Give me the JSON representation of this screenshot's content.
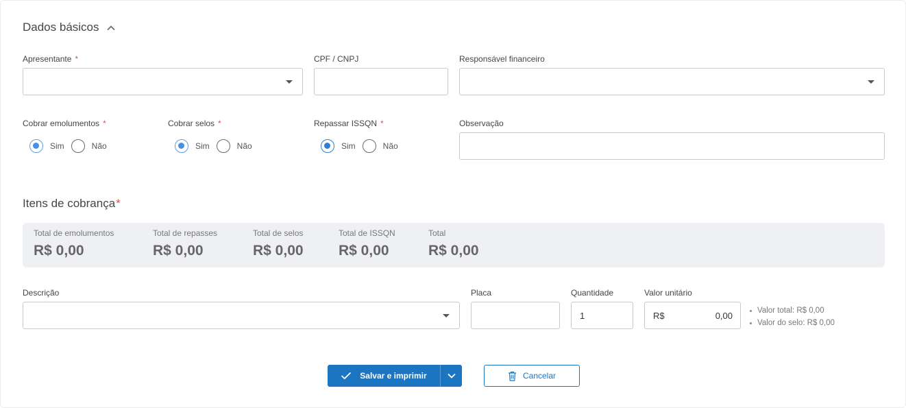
{
  "basic": {
    "title": "Dados básicos",
    "collapse_icon": "chevron-up-icon",
    "apresentante": {
      "label": "Apresentante",
      "required": "*",
      "value": ""
    },
    "cpf_cnpj": {
      "label": "CPF / CNPJ",
      "value": ""
    },
    "responsavel": {
      "label": "Responsável financeiro",
      "value": ""
    },
    "cobrar_emolumentos": {
      "label": "Cobrar emolumentos",
      "required": "*",
      "options": [
        "Sim",
        "Não"
      ],
      "selected": "Sim"
    },
    "cobrar_selos": {
      "label": "Cobrar selos",
      "required": "*",
      "options": [
        "Sim",
        "Não"
      ],
      "selected": "Sim"
    },
    "repassar_issqn": {
      "label": "Repassar ISSQN",
      "required": "*",
      "options": [
        "Sim",
        "Não"
      ],
      "selected": "Sim"
    },
    "observacao": {
      "label": "Observação",
      "value": ""
    }
  },
  "items": {
    "title": "Itens de cobrança",
    "required": "*",
    "totals": [
      {
        "label": "Total de emolumentos",
        "value": "R$ 0,00"
      },
      {
        "label": "Total de repasses",
        "value": "R$ 0,00"
      },
      {
        "label": "Total de selos",
        "value": "R$ 0,00"
      },
      {
        "label": "Total de ISSQN",
        "value": "R$ 0,00"
      },
      {
        "label": "Total",
        "value": "R$ 0,00"
      }
    ],
    "descricao": {
      "label": "Descrição",
      "value": ""
    },
    "placa": {
      "label": "Placa",
      "value": ""
    },
    "quantidade": {
      "label": "Quantidade",
      "value": "1"
    },
    "valor_unitario": {
      "label": "Valor unitário",
      "currency": "R$",
      "value": "0,00"
    },
    "summary": {
      "valor_total": "Valor total: R$ 0,00",
      "valor_selo": "Valor do selo: R$ 0,00"
    }
  },
  "actions": {
    "save_label": "Salvar e imprimir",
    "cancel_label": "Cancelar"
  },
  "colors": {
    "primary": "#1c75c0",
    "required": "#d9534f",
    "totals_background": "#eef0f3"
  }
}
